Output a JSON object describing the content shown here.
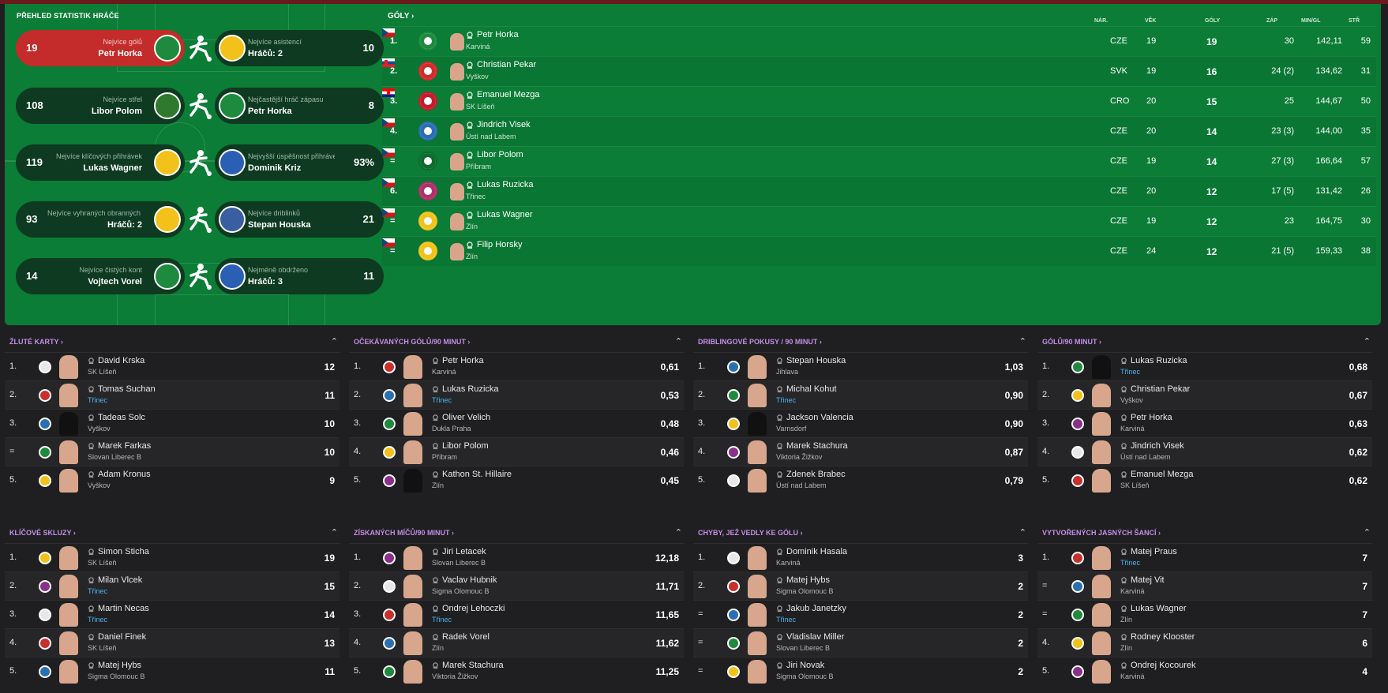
{
  "overview": {
    "title": "PŘEHLED STATISTIK HRÁČE",
    "left": [
      {
        "value": "19",
        "caption": "Nejvíce gólů",
        "name": "Petr Horka",
        "club_color": "#1e8a3e",
        "highlight": true
      },
      {
        "value": "108",
        "caption": "Nejvíce střel",
        "name": "Libor Polom",
        "club_color": "#2d7a2d",
        "highlight": false
      },
      {
        "value": "119",
        "caption": "Nejvíce klíčových přihrávek",
        "name": "Lukas Wagner",
        "club_color": "#f2c21b",
        "highlight": false
      },
      {
        "value": "93",
        "caption": "Nejvíce vyhraných obranných soubojů",
        "name": "Hráčů: 2",
        "club_color": "#f2c21b",
        "highlight": false
      },
      {
        "value": "14",
        "caption": "Nejvíce čistých kont",
        "name": "Vojtech Vorel",
        "club_color": "#1e8a3e",
        "highlight": false
      }
    ],
    "right": [
      {
        "value": "10",
        "caption": "Nejvíce asistencí",
        "name": "Hráčů: 2",
        "club_color": "#f2c21b"
      },
      {
        "value": "8",
        "caption": "Nejčastější hráč zápasu",
        "name": "Petr Horka",
        "club_color": "#1e8a3e"
      },
      {
        "value": "93%",
        "caption": "Nejvyšší úspěšnost přihrávek",
        "name": "Dominik Kriz",
        "club_color": "#2b5fb3"
      },
      {
        "value": "21",
        "caption": "Nejvíce driblinků",
        "name": "Stepan Houska",
        "club_color": "#3a5fa0"
      },
      {
        "value": "11",
        "caption": "Nejméně obdrženo",
        "name": "Hráčů: 3",
        "club_color": "#2b5fb3"
      }
    ]
  },
  "goals": {
    "title": "GÓLY",
    "columns": {
      "nat": "NÁR.",
      "age": "VĚK",
      "goals": "GÓLY",
      "apps": "ZÁP",
      "mpg": "MIN/GL",
      "rating": "STŘ"
    },
    "rows": [
      {
        "rank": "1.",
        "name": "Petr Horka",
        "club": "Karviná",
        "nat": "CZE",
        "age": "19",
        "goals": "19",
        "apps": "30",
        "mpg": "142,11",
        "rating": "59"
      },
      {
        "rank": "2.",
        "name": "Christian Pekar",
        "club": "Vyškov",
        "nat": "SVK",
        "age": "19",
        "goals": "16",
        "apps": "24 (2)",
        "mpg": "134,62",
        "rating": "31"
      },
      {
        "rank": "3.",
        "name": "Emanuel Mezga",
        "club": "SK Líšeň",
        "nat": "CRO",
        "age": "20",
        "goals": "15",
        "apps": "25",
        "mpg": "144,67",
        "rating": "50"
      },
      {
        "rank": "4.",
        "name": "Jindrich Visek",
        "club": "Ústí nad Labem",
        "nat": "CZE",
        "age": "20",
        "goals": "14",
        "apps": "23 (3)",
        "mpg": "144,00",
        "rating": "35"
      },
      {
        "rank": "=",
        "name": "Libor Polom",
        "club": "Příbram",
        "nat": "CZE",
        "age": "19",
        "goals": "14",
        "apps": "27 (3)",
        "mpg": "166,64",
        "rating": "57"
      },
      {
        "rank": "6.",
        "name": "Lukas Ruzicka",
        "club": "Třinec",
        "nat": "CZE",
        "age": "20",
        "goals": "12",
        "apps": "17 (5)",
        "mpg": "131,42",
        "rating": "26"
      },
      {
        "rank": "=",
        "name": "Lukas Wagner",
        "club": "Zlín",
        "nat": "CZE",
        "age": "19",
        "goals": "12",
        "apps": "23",
        "mpg": "164,75",
        "rating": "30"
      },
      {
        "rank": "=",
        "name": "Filip Horsky",
        "club": "Zlín",
        "nat": "CZE",
        "age": "24",
        "goals": "12",
        "apps": "21 (5)",
        "mpg": "159,33",
        "rating": "38"
      }
    ]
  },
  "panels": [
    {
      "title": "ŽLUTÉ KARTY",
      "rows": [
        {
          "rank": "1.",
          "name": "David Krska",
          "club": "SK Líšeň",
          "value": "12"
        },
        {
          "rank": "2.",
          "name": "Tomas Suchan",
          "club": "Třinec",
          "value": "11"
        },
        {
          "rank": "3.",
          "name": "Tadeas Solc",
          "club": "Vyškov",
          "value": "10"
        },
        {
          "rank": "=",
          "name": "Marek Farkas",
          "club": "Slovan Liberec B",
          "value": "10"
        },
        {
          "rank": "5.",
          "name": "Adam Kronus",
          "club": "Vyškov",
          "value": "9"
        }
      ]
    },
    {
      "title": "OČEKÁVANÝCH GÓLŮ/90 MINUT",
      "rows": [
        {
          "rank": "1.",
          "name": "Petr Horka",
          "club": "Karviná",
          "value": "0,61"
        },
        {
          "rank": "2.",
          "name": "Lukas Ruzicka",
          "club": "Třinec",
          "value": "0,53"
        },
        {
          "rank": "3.",
          "name": "Oliver Velich",
          "club": "Dukla Praha",
          "value": "0,48"
        },
        {
          "rank": "4.",
          "name": "Libor Polom",
          "club": "Příbram",
          "value": "0,46"
        },
        {
          "rank": "5.",
          "name": "Kathon St. Hillaire",
          "club": "Zlín",
          "value": "0,45"
        }
      ]
    },
    {
      "title": "DRIBLINGOVÉ POKUSY / 90 MINUT",
      "rows": [
        {
          "rank": "1.",
          "name": "Stepan Houska",
          "club": "Jihlava",
          "value": "1,03"
        },
        {
          "rank": "2.",
          "name": "Michal Kohut",
          "club": "Třinec",
          "value": "0,90"
        },
        {
          "rank": "3.",
          "name": "Jackson Valencia",
          "club": "Varnsdorf",
          "value": "0,90"
        },
        {
          "rank": "4.",
          "name": "Marek Stachura",
          "club": "Viktoria Žižkov",
          "value": "0,87"
        },
        {
          "rank": "5.",
          "name": "Zdenek Brabec",
          "club": "Ústí nad Labem",
          "value": "0,79"
        }
      ]
    },
    {
      "title": "GÓLŮ/90 MINUT",
      "rows": [
        {
          "rank": "1.",
          "name": "Lukas Ruzicka",
          "club": "Třinec",
          "value": "0,68"
        },
        {
          "rank": "2.",
          "name": "Christian Pekar",
          "club": "Vyškov",
          "value": "0,67"
        },
        {
          "rank": "3.",
          "name": "Petr Horka",
          "club": "Karviná",
          "value": "0,63"
        },
        {
          "rank": "4.",
          "name": "Jindrich Visek",
          "club": "Ústí nad Labem",
          "value": "0,62"
        },
        {
          "rank": "5.",
          "name": "Emanuel Mezga",
          "club": "SK Líšeň",
          "value": "0,62"
        }
      ]
    },
    {
      "title": "KLÍČOVÉ SKLUZY",
      "rows": [
        {
          "rank": "1.",
          "name": "Simon Sticha",
          "club": "SK Líšeň",
          "value": "19"
        },
        {
          "rank": "2.",
          "name": "Milan Vlcek",
          "club": "Třinec",
          "value": "15"
        },
        {
          "rank": "3.",
          "name": "Martin Necas",
          "club": "Třinec",
          "value": "14"
        },
        {
          "rank": "4.",
          "name": "Daniel Finek",
          "club": "SK Líšeň",
          "value": "13"
        },
        {
          "rank": "5.",
          "name": "Matej Hybs",
          "club": "Sigma Olomouc B",
          "value": "11"
        }
      ]
    },
    {
      "title": "ZÍSKANÝCH MÍČŮ/90 MINUT",
      "rows": [
        {
          "rank": "1.",
          "name": "Jiri Letacek",
          "club": "Slovan Liberec B",
          "value": "12,18"
        },
        {
          "rank": "2.",
          "name": "Vaclav Hubnik",
          "club": "Sigma Olomouc B",
          "value": "11,71"
        },
        {
          "rank": "3.",
          "name": "Ondrej Lehoczki",
          "club": "Třinec",
          "value": "11,65"
        },
        {
          "rank": "4.",
          "name": "Radek Vorel",
          "club": "Zlín",
          "value": "11,62"
        },
        {
          "rank": "5.",
          "name": "Marek Stachura",
          "club": "Viktoria Žižkov",
          "value": "11,25"
        }
      ]
    },
    {
      "title": "CHYBY, JEŽ VEDLY KE GÓLU",
      "rows": [
        {
          "rank": "1.",
          "name": "Dominik Hasala",
          "club": "Karviná",
          "value": "3"
        },
        {
          "rank": "2.",
          "name": "Matej Hybs",
          "club": "Sigma Olomouc B",
          "value": "2"
        },
        {
          "rank": "=",
          "name": "Jakub Janetzky",
          "club": "Třinec",
          "value": "2"
        },
        {
          "rank": "=",
          "name": "Vladislav Miller",
          "club": "Slovan Liberec B",
          "value": "2"
        },
        {
          "rank": "=",
          "name": "Jiri Novak",
          "club": "Sigma Olomouc B",
          "value": "2"
        }
      ]
    },
    {
      "title": "VYTVOŘENÝCH JASNÝCH ŠANCÍ",
      "rows": [
        {
          "rank": "1.",
          "name": "Matej Praus",
          "club": "Třinec",
          "value": "7"
        },
        {
          "rank": "=",
          "name": "Matej Vit",
          "club": "Karviná",
          "value": "7"
        },
        {
          "rank": "=",
          "name": "Lukas Wagner",
          "club": "Zlín",
          "value": "7"
        },
        {
          "rank": "4.",
          "name": "Rodney Klooster",
          "club": "Zlín",
          "value": "6"
        },
        {
          "rank": "5.",
          "name": "Ondrej Kocourek",
          "club": "Karviná",
          "value": "4"
        }
      ]
    }
  ],
  "colors": {
    "accent_green": "#0b7d36",
    "highlight_red": "#c42b2b",
    "panel_title": "#c48ee6",
    "trinec_blue": "#49b5f0"
  }
}
